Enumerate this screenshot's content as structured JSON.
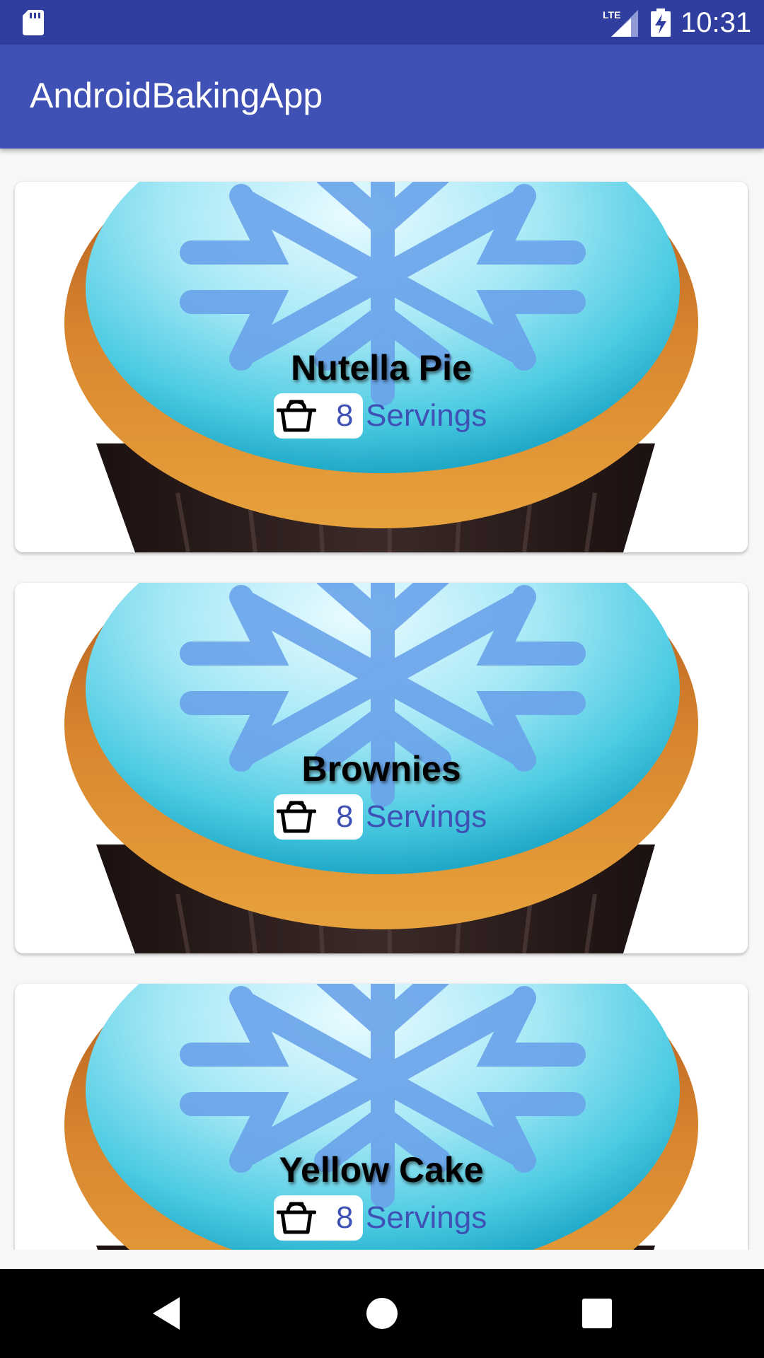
{
  "status_bar": {
    "time": "10:31",
    "network_label": "LTE",
    "icons": [
      "sd-card-icon",
      "lte-signal-icon",
      "battery-charging-icon"
    ]
  },
  "app_bar": {
    "title": "AndroidBakingApp"
  },
  "recipes": [
    {
      "name": "Nutella Pie",
      "servings_count": "8",
      "servings_label": "Servings",
      "image": "cupcake-snowflake-image",
      "icon": "pot-icon"
    },
    {
      "name": "Brownies",
      "servings_count": "8",
      "servings_label": "Servings",
      "image": "cupcake-snowflake-image",
      "icon": "pot-icon"
    },
    {
      "name": "Yellow Cake",
      "servings_count": "8",
      "servings_label": "Servings",
      "image": "cupcake-snowflake-image",
      "icon": "pot-icon"
    }
  ],
  "nav_bar": {
    "icons": [
      "back-icon",
      "home-icon",
      "recents-icon"
    ]
  },
  "colors": {
    "status_bar": "#303f9f",
    "app_bar": "#3f51b5",
    "accent_text": "#3f51b5",
    "frosting": "#3cc0dc",
    "snowflake": "#6aa3ea",
    "cake": "#c96f27",
    "liner": "#2a1c1a"
  }
}
